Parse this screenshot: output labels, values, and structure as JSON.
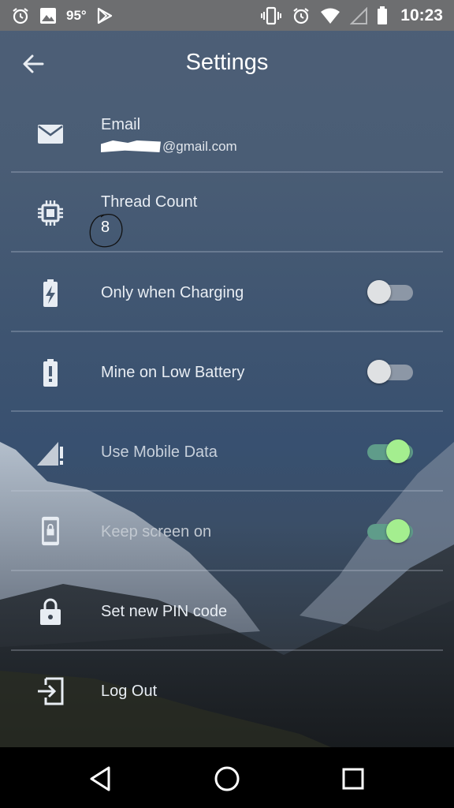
{
  "status_bar": {
    "temperature": "95°",
    "time": "10:23",
    "icons": [
      "alarm-icon",
      "image-icon",
      "play-store-icon",
      "vibrate-icon",
      "alarm-icon",
      "wifi-icon",
      "signal-icon",
      "battery-icon"
    ]
  },
  "toolbar": {
    "title": "Settings",
    "back_icon": "arrow-back-icon"
  },
  "settings": {
    "email": {
      "label": "Email",
      "value_suffix": "@gmail.com",
      "icon": "mail-icon"
    },
    "thread_count": {
      "label": "Thread Count",
      "value": "8",
      "icon": "cpu-chip-icon"
    },
    "only_when_charging": {
      "label": "Only when Charging",
      "enabled": false,
      "icon": "battery-charging-icon"
    },
    "mine_on_low_battery": {
      "label": "Mine on Low Battery",
      "enabled": false,
      "icon": "battery-alert-icon"
    },
    "use_mobile_data": {
      "label": "Use Mobile Data",
      "enabled": true,
      "icon": "signal-alert-icon"
    },
    "keep_screen_on": {
      "label": "Keep screen on",
      "enabled": true,
      "icon": "screen-lock-icon"
    },
    "set_pin": {
      "label": "Set new PIN code",
      "icon": "lock-icon"
    },
    "log_out": {
      "label": "Log Out",
      "icon": "exit-icon"
    }
  },
  "nav_bar": {
    "icons": [
      "back-triangle-icon",
      "home-circle-icon",
      "recents-square-icon"
    ]
  },
  "colors": {
    "status_bar": "#6d6e70",
    "toggle_on_thumb": "#a4ee8f",
    "toggle_on_track": "#5f9c8a",
    "toggle_off_thumb": "#dfe1e3",
    "toggle_off_track": "#8c97a6"
  }
}
